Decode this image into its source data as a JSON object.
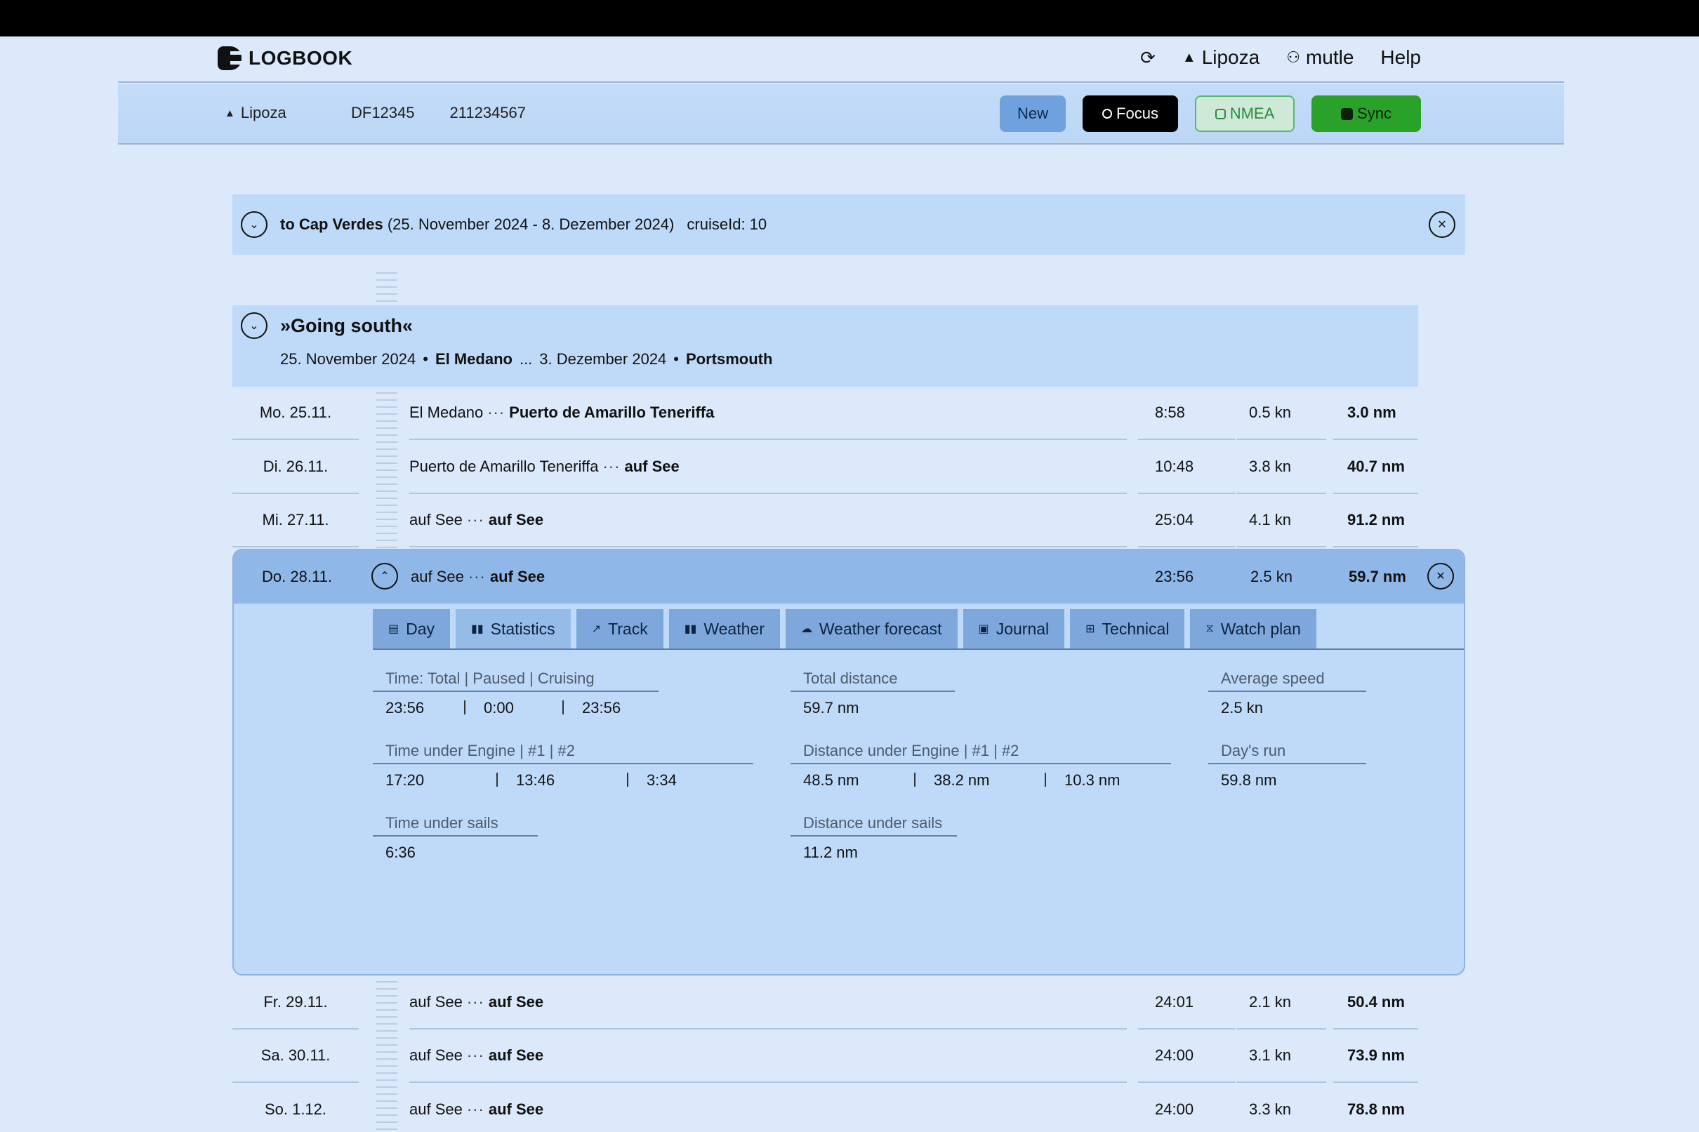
{
  "header": {
    "app_name": "LOGBOOK",
    "nav": {
      "boat": "Lipoza",
      "user": "mutle",
      "help": "Help"
    }
  },
  "toolbar": {
    "boat": "Lipoza",
    "call_sign": "DF12345",
    "mmsi": "211234567",
    "buttons": {
      "new": "New",
      "focus": "Focus",
      "nmea": "NMEA",
      "sync": "Sync"
    },
    "colors": {
      "new": "#6fa1de",
      "focus": "#000000",
      "nmea": "#cfe9d9",
      "sync": "#2aa22a"
    }
  },
  "cruise": {
    "name": "to Cap Verdes",
    "dates": "(25. November 2024 - 8. Dezember 2024)",
    "id": "cruiseId: 10"
  },
  "trip": {
    "title": "»Going south«",
    "start_date": "25. November 2024",
    "start_place": "El Medano",
    "ellipsis": "...",
    "end_date": "3. Dezember 2024",
    "end_place": "Portsmouth"
  },
  "days": [
    {
      "date": "Mo. 25.11.",
      "from": "El Medano",
      "to": "Puerto de Amarillo Teneriffa",
      "time": "8:58",
      "speed": "0.5 kn",
      "distance": "3.0 nm"
    },
    {
      "date": "Di. 26.11.",
      "from": "Puerto de Amarillo Teneriffa",
      "to": "auf See",
      "time": "10:48",
      "speed": "3.8 kn",
      "distance": "40.7 nm"
    },
    {
      "date": "Mi. 27.11.",
      "from": "auf See",
      "to": "auf See",
      "time": "25:04",
      "speed": "4.1 kn",
      "distance": "91.2 nm"
    },
    {
      "date": "Do. 28.11.",
      "from": "auf See",
      "to": "auf See",
      "time": "23:56",
      "speed": "2.5 kn",
      "distance": "59.7 nm"
    },
    {
      "date": "Fr. 29.11.",
      "from": "auf See",
      "to": "auf See",
      "time": "24:01",
      "speed": "2.1 kn",
      "distance": "50.4 nm"
    },
    {
      "date": "Sa. 30.11.",
      "from": "auf See",
      "to": "auf See",
      "time": "24:00",
      "speed": "3.1 kn",
      "distance": "73.9 nm"
    },
    {
      "date": "So. 1.12.",
      "from": "auf See",
      "to": "auf See",
      "time": "24:00",
      "speed": "3.3 kn",
      "distance": "78.8 nm"
    }
  ],
  "route_separator": "···",
  "tabs": [
    {
      "label": "Day",
      "icon": "calendar-icon"
    },
    {
      "label": "Statistics",
      "icon": "bar-chart-icon"
    },
    {
      "label": "Track",
      "icon": "track-icon"
    },
    {
      "label": "Weather",
      "icon": "weather-icon"
    },
    {
      "label": "Weather forecast",
      "icon": "forecast-icon"
    },
    {
      "label": "Journal",
      "icon": "journal-icon"
    },
    {
      "label": "Technical",
      "icon": "technical-icon"
    },
    {
      "label": "Watch plan",
      "icon": "hourglass-icon"
    }
  ],
  "active_tab": "Statistics",
  "statistics": {
    "time": {
      "label": "Time: Total | Paused | Cruising",
      "total": "23:56",
      "paused": "0:00",
      "cruising": "23:56"
    },
    "total_distance": {
      "label": "Total distance",
      "value": "59.7 nm"
    },
    "average_speed": {
      "label": "Average speed",
      "value": "2.5 kn"
    },
    "time_engine": {
      "label": "Time under Engine | #1 | #2",
      "total": "17:20",
      "e1": "13:46",
      "e2": "3:34"
    },
    "distance_engine": {
      "label": "Distance under Engine | #1 | #2",
      "total": "48.5 nm",
      "e1": "38.2 nm",
      "e2": "10.3 nm"
    },
    "days_run": {
      "label": "Day's run",
      "value": "59.8 nm"
    },
    "time_sails": {
      "label": "Time under sails",
      "value": "6:36"
    },
    "distance_sails": {
      "label": "Distance under sails",
      "value": "11.2 nm"
    }
  }
}
